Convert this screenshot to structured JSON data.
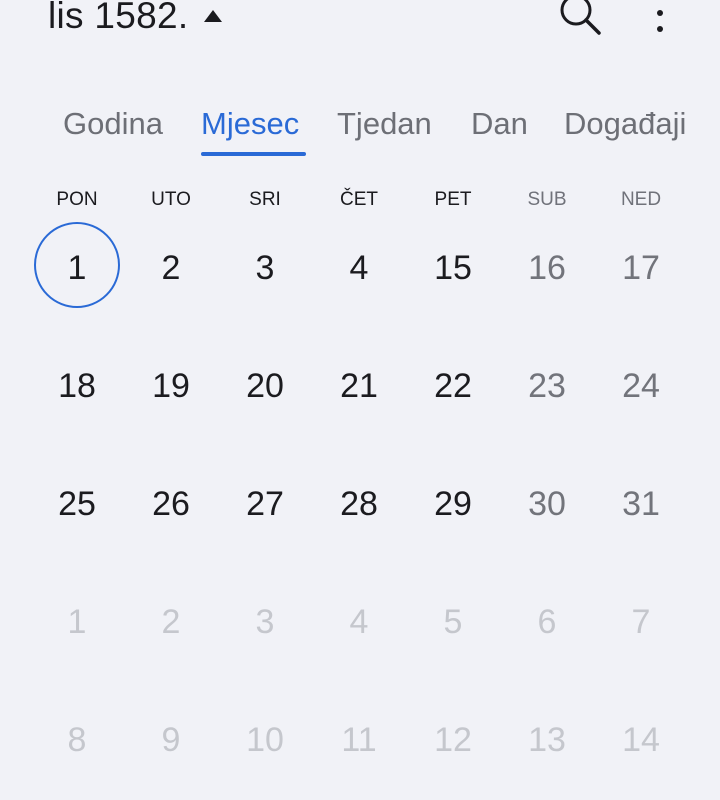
{
  "header": {
    "title": "lis 1582.",
    "icons": {
      "expand": "triangle-up-icon",
      "search": "search-icon",
      "more": "more-vertical-icon"
    }
  },
  "tabs": [
    {
      "label": "Godina",
      "active": false
    },
    {
      "label": "Mjesec",
      "active": true
    },
    {
      "label": "Tjedan",
      "active": false
    },
    {
      "label": "Dan",
      "active": false
    },
    {
      "label": "Događaji",
      "active": false
    }
  ],
  "weekdays": [
    "PON",
    "UTO",
    "SRI",
    "ČET",
    "PET",
    "SUB",
    "NED"
  ],
  "weeks": [
    [
      "1",
      "2",
      "3",
      "4",
      "15",
      "16",
      "17"
    ],
    [
      "18",
      "19",
      "20",
      "21",
      "22",
      "23",
      "24"
    ],
    [
      "25",
      "26",
      "27",
      "28",
      "29",
      "30",
      "31"
    ],
    [
      "1",
      "2",
      "3",
      "4",
      "5",
      "6",
      "7"
    ],
    [
      "8",
      "9",
      "10",
      "11",
      "12",
      "13",
      "14"
    ]
  ],
  "current_month_weeks": 3,
  "today": "1",
  "colors": {
    "accent": "#2a6ad6",
    "background": "#f1f2f7",
    "muted": "#c5c7cd"
  }
}
